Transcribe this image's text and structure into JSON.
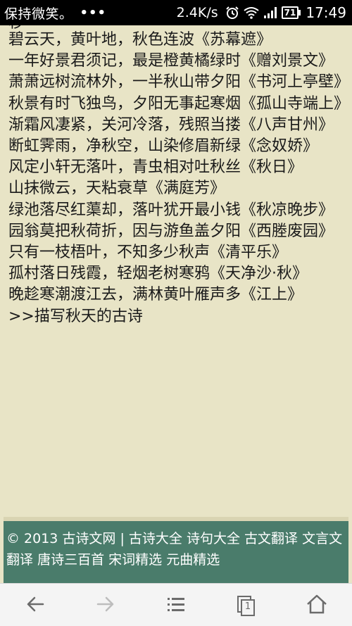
{
  "status_bar": {
    "app_name": "保持微笑。",
    "dots": "•••",
    "speed": "2.4K/s",
    "battery": "71",
    "time": "17:49"
  },
  "content": {
    "partial_top": "秒",
    "poems": [
      "碧云天，黄叶地，秋色连波《苏幕遮》",
      "一年好景君须记，最是橙黄橘绿时《赠刘景文》",
      "萧萧远树流林外，一半秋山带夕阳《书河上亭壁》",
      "秋景有时飞独鸟，夕阳无事起寒烟《孤山寺端上》",
      "渐霜风凄紧，关河冷落，残照当搂《八声甘州》",
      "断虹霁雨，净秋空，山染修眉新绿《念奴娇》",
      "风定小轩无落叶，青虫相对吐秋丝《秋日》",
      "山抹微云，天粘衰草《满庭芳》",
      "绿池落尽红蕖却，落叶犹开最小钱《秋凉晚步》",
      "园翁莫把秋荷折，因与游鱼盖夕阳《西塍废园》",
      "只有一枝梧叶，不知多少秋声《清平乐》",
      "孤村落日残霞，轻烟老树寒鸦《天净沙·秋》",
      "晚趁寒潮渡江去，满林黄叶雁声多《江上》"
    ],
    "more_link": ">>描写秋天的古诗"
  },
  "footer": {
    "copyright": "© 2013 古诗文网 |",
    "links": [
      "古诗大全",
      "诗句大全",
      "古文翻译",
      "文言文翻译",
      "唐诗三百首",
      "宋词精选",
      "元曲精选"
    ]
  },
  "nav": {
    "icons": [
      "back-arrow-icon",
      "forward-arrow-icon",
      "menu-icon",
      "tabs-icon",
      "home-icon"
    ],
    "tab_count": "1"
  },
  "colors": {
    "page_bg": "#e8e4c6",
    "footer_bg": "#4a7c6b",
    "status_bar_bg": "#000000",
    "nav_bg": "#f4f4f4"
  }
}
